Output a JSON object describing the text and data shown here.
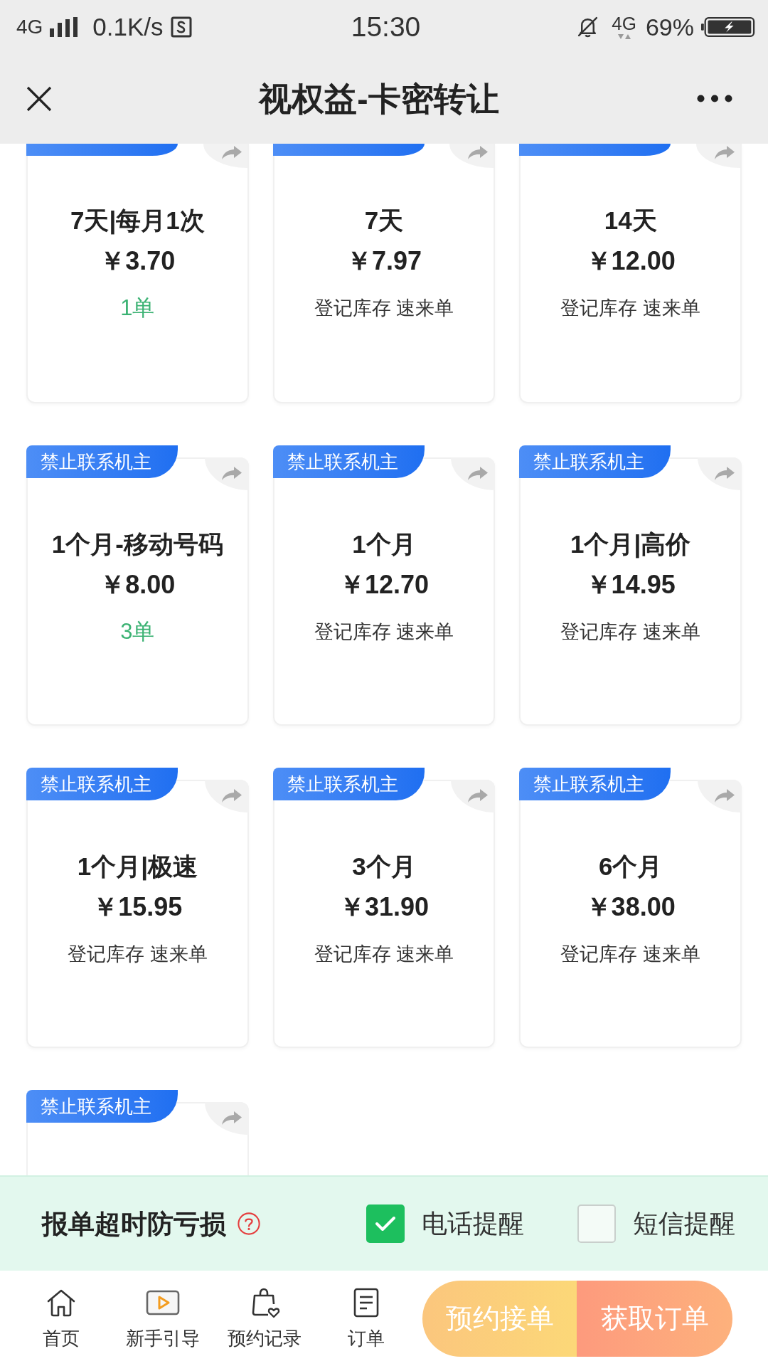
{
  "status_bar": {
    "network": "4G",
    "speed": "0.1K/s",
    "time": "15:30",
    "network_right": "4G",
    "battery": "69%"
  },
  "header": {
    "title": "视权益-卡密转让"
  },
  "cards": [
    {
      "title": "7天|每月1次",
      "price": "￥3.70",
      "note": {
        "text": "1单",
        "kind": "count"
      }
    },
    {
      "title": "7天",
      "price": "￥7.97",
      "note": {
        "text": "登记库存 速来单",
        "kind": "hint"
      }
    },
    {
      "title": "14天",
      "price": "￥12.00",
      "note": {
        "text": "登记库存 速来单",
        "kind": "hint"
      }
    },
    {
      "badge": "禁止联系机主",
      "title": "1个月-移动号码",
      "price": "￥8.00",
      "note": {
        "text": "3单",
        "kind": "count"
      }
    },
    {
      "badge": "禁止联系机主",
      "title": "1个月",
      "price": "￥12.70",
      "note": {
        "text": "登记库存 速来单",
        "kind": "hint"
      }
    },
    {
      "badge": "禁止联系机主",
      "title": "1个月|高价",
      "price": "￥14.95",
      "note": {
        "text": "登记库存 速来单",
        "kind": "hint"
      }
    },
    {
      "badge": "禁止联系机主",
      "title": "1个月|极速",
      "price": "￥15.95",
      "note": {
        "text": "登记库存 速来单",
        "kind": "hint"
      }
    },
    {
      "badge": "禁止联系机主",
      "title": "3个月",
      "price": "￥31.90",
      "note": {
        "text": "登记库存 速来单",
        "kind": "hint"
      }
    },
    {
      "badge": "禁止联系机主",
      "title": "6个月",
      "price": "￥38.00",
      "note": {
        "text": "登记库存 速来单",
        "kind": "hint"
      }
    },
    {
      "badge": "禁止联系机主"
    }
  ],
  "reminder_bar": {
    "title": "报单超时防亏损",
    "options": [
      {
        "label": "电话提醒",
        "checked": true
      },
      {
        "label": "短信提醒",
        "checked": false
      }
    ]
  },
  "nav": [
    {
      "label": "首页"
    },
    {
      "label": "新手引导"
    },
    {
      "label": "预约记录"
    },
    {
      "label": "订单"
    }
  ],
  "actions": [
    {
      "label": "预约接单"
    },
    {
      "label": "获取订单"
    }
  ]
}
